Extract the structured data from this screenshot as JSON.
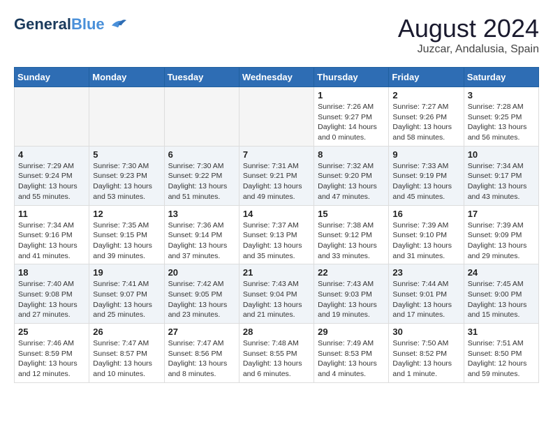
{
  "header": {
    "logo_line1": "General",
    "logo_line2": "Blue",
    "month_year": "August 2024",
    "location": "Juzcar, Andalusia, Spain"
  },
  "weekdays": [
    "Sunday",
    "Monday",
    "Tuesday",
    "Wednesday",
    "Thursday",
    "Friday",
    "Saturday"
  ],
  "weeks": [
    [
      {
        "day": "",
        "info": ""
      },
      {
        "day": "",
        "info": ""
      },
      {
        "day": "",
        "info": ""
      },
      {
        "day": "",
        "info": ""
      },
      {
        "day": "1",
        "info": "Sunrise: 7:26 AM\nSunset: 9:27 PM\nDaylight: 14 hours\nand 0 minutes."
      },
      {
        "day": "2",
        "info": "Sunrise: 7:27 AM\nSunset: 9:26 PM\nDaylight: 13 hours\nand 58 minutes."
      },
      {
        "day": "3",
        "info": "Sunrise: 7:28 AM\nSunset: 9:25 PM\nDaylight: 13 hours\nand 56 minutes."
      }
    ],
    [
      {
        "day": "4",
        "info": "Sunrise: 7:29 AM\nSunset: 9:24 PM\nDaylight: 13 hours\nand 55 minutes."
      },
      {
        "day": "5",
        "info": "Sunrise: 7:30 AM\nSunset: 9:23 PM\nDaylight: 13 hours\nand 53 minutes."
      },
      {
        "day": "6",
        "info": "Sunrise: 7:30 AM\nSunset: 9:22 PM\nDaylight: 13 hours\nand 51 minutes."
      },
      {
        "day": "7",
        "info": "Sunrise: 7:31 AM\nSunset: 9:21 PM\nDaylight: 13 hours\nand 49 minutes."
      },
      {
        "day": "8",
        "info": "Sunrise: 7:32 AM\nSunset: 9:20 PM\nDaylight: 13 hours\nand 47 minutes."
      },
      {
        "day": "9",
        "info": "Sunrise: 7:33 AM\nSunset: 9:19 PM\nDaylight: 13 hours\nand 45 minutes."
      },
      {
        "day": "10",
        "info": "Sunrise: 7:34 AM\nSunset: 9:17 PM\nDaylight: 13 hours\nand 43 minutes."
      }
    ],
    [
      {
        "day": "11",
        "info": "Sunrise: 7:34 AM\nSunset: 9:16 PM\nDaylight: 13 hours\nand 41 minutes."
      },
      {
        "day": "12",
        "info": "Sunrise: 7:35 AM\nSunset: 9:15 PM\nDaylight: 13 hours\nand 39 minutes."
      },
      {
        "day": "13",
        "info": "Sunrise: 7:36 AM\nSunset: 9:14 PM\nDaylight: 13 hours\nand 37 minutes."
      },
      {
        "day": "14",
        "info": "Sunrise: 7:37 AM\nSunset: 9:13 PM\nDaylight: 13 hours\nand 35 minutes."
      },
      {
        "day": "15",
        "info": "Sunrise: 7:38 AM\nSunset: 9:12 PM\nDaylight: 13 hours\nand 33 minutes."
      },
      {
        "day": "16",
        "info": "Sunrise: 7:39 AM\nSunset: 9:10 PM\nDaylight: 13 hours\nand 31 minutes."
      },
      {
        "day": "17",
        "info": "Sunrise: 7:39 AM\nSunset: 9:09 PM\nDaylight: 13 hours\nand 29 minutes."
      }
    ],
    [
      {
        "day": "18",
        "info": "Sunrise: 7:40 AM\nSunset: 9:08 PM\nDaylight: 13 hours\nand 27 minutes."
      },
      {
        "day": "19",
        "info": "Sunrise: 7:41 AM\nSunset: 9:07 PM\nDaylight: 13 hours\nand 25 minutes."
      },
      {
        "day": "20",
        "info": "Sunrise: 7:42 AM\nSunset: 9:05 PM\nDaylight: 13 hours\nand 23 minutes."
      },
      {
        "day": "21",
        "info": "Sunrise: 7:43 AM\nSunset: 9:04 PM\nDaylight: 13 hours\nand 21 minutes."
      },
      {
        "day": "22",
        "info": "Sunrise: 7:43 AM\nSunset: 9:03 PM\nDaylight: 13 hours\nand 19 minutes."
      },
      {
        "day": "23",
        "info": "Sunrise: 7:44 AM\nSunset: 9:01 PM\nDaylight: 13 hours\nand 17 minutes."
      },
      {
        "day": "24",
        "info": "Sunrise: 7:45 AM\nSunset: 9:00 PM\nDaylight: 13 hours\nand 15 minutes."
      }
    ],
    [
      {
        "day": "25",
        "info": "Sunrise: 7:46 AM\nSunset: 8:59 PM\nDaylight: 13 hours\nand 12 minutes."
      },
      {
        "day": "26",
        "info": "Sunrise: 7:47 AM\nSunset: 8:57 PM\nDaylight: 13 hours\nand 10 minutes."
      },
      {
        "day": "27",
        "info": "Sunrise: 7:47 AM\nSunset: 8:56 PM\nDaylight: 13 hours\nand 8 minutes."
      },
      {
        "day": "28",
        "info": "Sunrise: 7:48 AM\nSunset: 8:55 PM\nDaylight: 13 hours\nand 6 minutes."
      },
      {
        "day": "29",
        "info": "Sunrise: 7:49 AM\nSunset: 8:53 PM\nDaylight: 13 hours\nand 4 minutes."
      },
      {
        "day": "30",
        "info": "Sunrise: 7:50 AM\nSunset: 8:52 PM\nDaylight: 13 hours\nand 1 minute."
      },
      {
        "day": "31",
        "info": "Sunrise: 7:51 AM\nSunset: 8:50 PM\nDaylight: 12 hours\nand 59 minutes."
      }
    ]
  ]
}
